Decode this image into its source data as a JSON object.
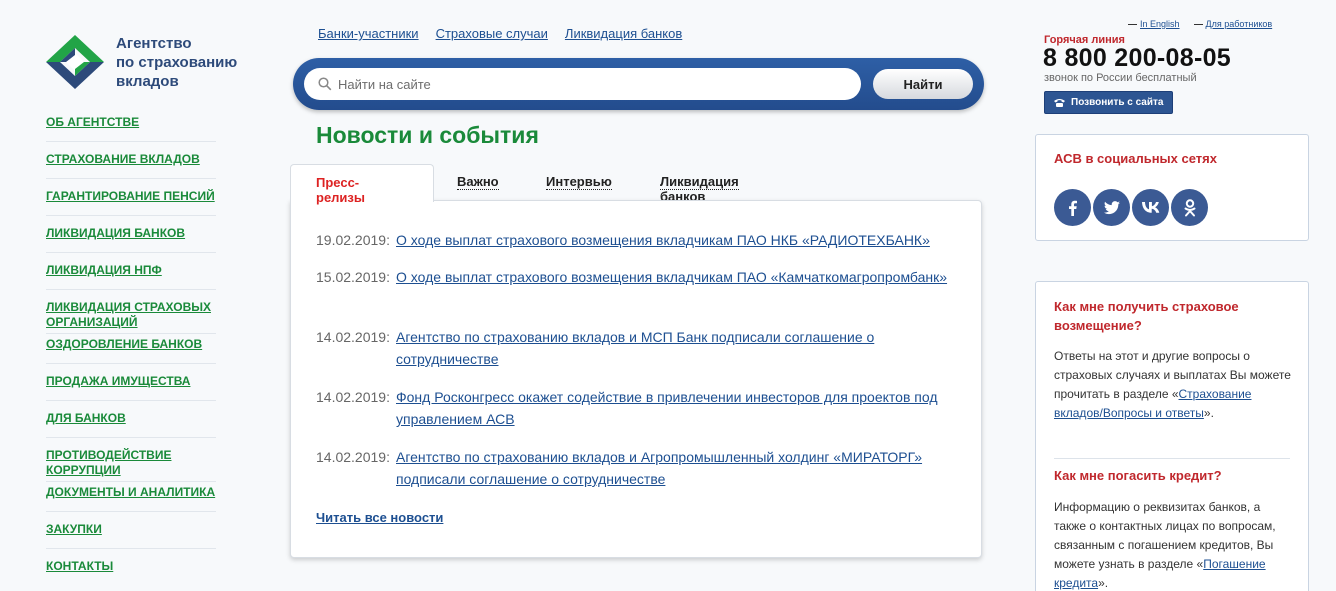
{
  "logo": {
    "line1": "Агентство",
    "line2": "по страхованию",
    "line3": "вкладов",
    "icon": "asv-logo-icon",
    "brand_green": "#22a447",
    "brand_blue": "#2d4a7a"
  },
  "left_nav": [
    {
      "label": "ОБ АГЕНТСТВЕ"
    },
    {
      "label": "СТРАХОВАНИЕ ВКЛАДОВ"
    },
    {
      "label": "ГАРАНТИРОВАНИЕ ПЕНСИЙ"
    },
    {
      "label": "ЛИКВИДАЦИЯ БАНКОВ"
    },
    {
      "label": "ЛИКВИДАЦИЯ НПФ"
    },
    {
      "label": "ЛИКВИДАЦИЯ СТРАХОВЫХ ОРГАНИЗАЦИЙ"
    },
    {
      "label": "ОЗДОРОВЛЕНИЕ БАНКОВ"
    },
    {
      "label": "ПРОДАЖА ИМУЩЕСТВА"
    },
    {
      "label": "ДЛЯ БАНКОВ"
    },
    {
      "label": "ПРОТИВОДЕЙСТВИЕ КОРРУПЦИИ"
    },
    {
      "label": "ДОКУМЕНТЫ И АНАЛИТИКА"
    },
    {
      "label": "ЗАКУПКИ"
    },
    {
      "label": "КОНТАКТЫ"
    }
  ],
  "top_links": [
    {
      "label": "Банки-участники"
    },
    {
      "label": "Страховые случаи"
    },
    {
      "label": "Ликвидация банков"
    }
  ],
  "search": {
    "placeholder": "Найти на сайте",
    "button_label": "Найти",
    "icon": "search-icon"
  },
  "page_title": "Новости и события",
  "tabs": [
    {
      "label": "Пресс-релизы",
      "active": true
    },
    {
      "label": "Важно",
      "active": false
    },
    {
      "label": "Интервью",
      "active": false
    },
    {
      "label": "Ликвидация банков",
      "active": false
    }
  ],
  "news": [
    {
      "date": "19.02.2019:",
      "title": "О ходе выплат страхового возмещения вкладчикам ПАО НКБ «РАДИОТЕХБАНК»"
    },
    {
      "date": "15.02.2019:",
      "title": "О ходе выплат страхового возмещения вкладчикам ПАО «Камчаткомагропромбанк»"
    },
    {
      "date": "14.02.2019:",
      "title": "Агентство по страхованию вкладов и МСП Банк подписали соглашение о сотрудничестве"
    },
    {
      "date": "14.02.2019:",
      "title": "Фонд Росконгресс окажет содействие в привлечении инвесторов для проектов под управлением АСВ"
    },
    {
      "date": "14.02.2019:",
      "title": "Агентство по страхованию вкладов и Агропромышленный холдинг «МИРАТОРГ» подписали соглашение о сотрудничестве"
    }
  ],
  "read_all": "Читать все новости",
  "lang_links": {
    "english": "In English",
    "staff": "Для работников"
  },
  "hotline": {
    "label": "Горячая линия",
    "number": "8 800 200-08-05",
    "note": "звонок по России бесплатный",
    "call_button": "Позвонить с сайта",
    "call_icon": "phone-icon"
  },
  "social": {
    "title": "АСВ в социальных сетях",
    "icons": [
      "facebook-icon",
      "twitter-icon",
      "vk-icon",
      "odnoklassniki-icon"
    ]
  },
  "faq": [
    {
      "question": "Как мне получить страховое возмещение?",
      "answer_before": "Ответы на этот и другие вопросы о страховых случаях и выплатах Вы можете прочитать в разделе «",
      "link": "Страхование вкладов/Вопросы и ответы",
      "answer_after": "»."
    },
    {
      "question": "Как мне погасить кредит?",
      "answer_before": "Информацию о реквизитах банков, а также о контактных лицах по вопросам, связанным с погашением кредитов, Вы можете узнать в разделе «",
      "link": "Погашение кредита",
      "answer_after": "»."
    }
  ],
  "colors": {
    "nav_green": "#1a8a3a",
    "link_blue": "#1d4f91",
    "accent_red": "#c0282d",
    "search_blue": "#2e5fa6"
  }
}
